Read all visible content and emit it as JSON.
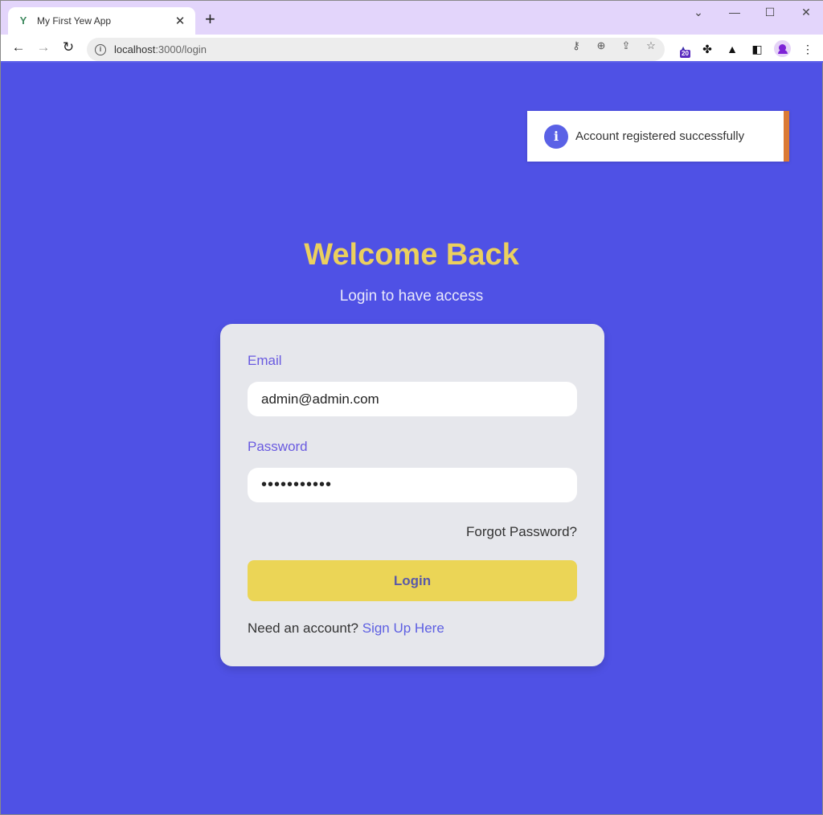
{
  "browser": {
    "tab_title": "My First Yew App",
    "tab_favicon": "Y",
    "close_glyph": "✕",
    "new_tab_glyph": "+",
    "url_host": "localhost",
    "url_rest": ":3000/login",
    "extension_badge": "20",
    "window_controls": {
      "dropdown": "⌄",
      "minimize": "—",
      "maximize": "☐",
      "close": "✕"
    },
    "nav": {
      "back": "←",
      "forward": "→",
      "reload": "↻"
    },
    "menu_glyph": "⋮"
  },
  "toast": {
    "icon": "i",
    "message": "Account registered successfully",
    "accent_color": "#db7a35"
  },
  "page": {
    "title": "Welcome Back",
    "subtitle": "Login to have access"
  },
  "form": {
    "email_label": "Email",
    "email_value": "admin@admin.com",
    "password_label": "Password",
    "password_value": "•••••••••••",
    "forgot_label": "Forgot Password?",
    "login_label": "Login",
    "need_account": "Need an account?",
    "signup_label": "Sign Up Here"
  },
  "colors": {
    "background": "#4f51e5",
    "title": "#ebd05e",
    "button": "#ebd556",
    "label": "#6a5be0"
  }
}
